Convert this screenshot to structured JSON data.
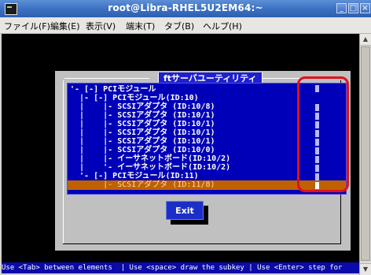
{
  "window": {
    "title": "root@Libra-RHEL5U2EM64:~",
    "buttons": {
      "minimize": "_",
      "maximize": "□",
      "close": "×"
    }
  },
  "menu": {
    "items": [
      "ファイル(F)",
      "編集(E)",
      "表示(V)",
      "端末(T)",
      "タブ(B)",
      "ヘルプ(H)"
    ]
  },
  "dialog": {
    "title": "ftサーバユーティリティ",
    "rows": [
      "'- [-] PCIモジュール",
      "  |- [-] PCIモジュール(ID:10)",
      "  |    |- SCSIアダプタ (ID:10/8)",
      "  |    |- SCSIアダプタ (ID:10/1)",
      "  |    |- SCSIアダプタ (ID:10/1)",
      "  |    |- SCSIアダプタ (ID:10/1)",
      "  |    |- SCSIアダプタ (ID:10/1)",
      "  |    |- SCSIアダプタ (ID:10/0)",
      "  |    |- イーサネットボード(ID:10/2)",
      "  |    '- イーサネットボード(ID:10/2)",
      "  '- [-] PCIモジュール(ID:11)",
      "       |- SCSIアダプタ (ID:11/8)"
    ],
    "selected_index": 11,
    "exit_label": "Exit"
  },
  "status": {
    "text": "Use <Tab> between elements  | Use <space> draw the subkey | Use <Enter> step for"
  },
  "colors": {
    "title_bar": "#3a6fc0",
    "terminal_bg": "#000000",
    "dialog_bg": "#c0c0c0",
    "list_bg": "#0000b8",
    "selected_row": "#bf6100",
    "highlight": "#e0121a"
  },
  "icons": {
    "app": "terminal-icon",
    "scroll_up": "arrow-up-icon",
    "scroll_down": "arrow-down-icon"
  }
}
